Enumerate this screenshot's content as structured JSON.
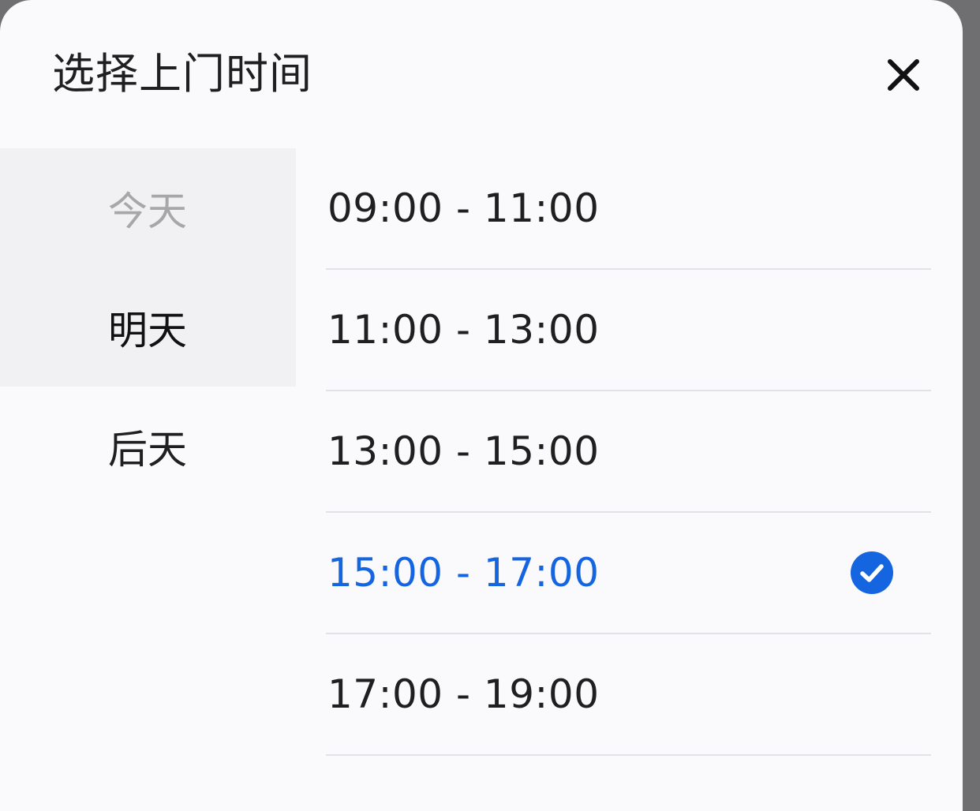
{
  "header": {
    "title": "选择上门时间",
    "close_icon": "close-icon"
  },
  "days": [
    {
      "label": "今天",
      "state": "disabled"
    },
    {
      "label": "明天",
      "state": "selected"
    },
    {
      "label": "后天",
      "state": "normal"
    }
  ],
  "slots": [
    {
      "label": "09:00 - 11:00",
      "selected": false
    },
    {
      "label": "11:00 - 13:00",
      "selected": false
    },
    {
      "label": "13:00 - 15:00",
      "selected": false
    },
    {
      "label": "15:00 - 17:00",
      "selected": true
    },
    {
      "label": "17:00 - 19:00",
      "selected": false
    }
  ],
  "colors": {
    "accent": "#1565e0",
    "sheet_bg": "#fafafc",
    "selected_day_bg": "#f1f1f3"
  },
  "icons": {
    "selected_marker": "check-circle-icon"
  }
}
